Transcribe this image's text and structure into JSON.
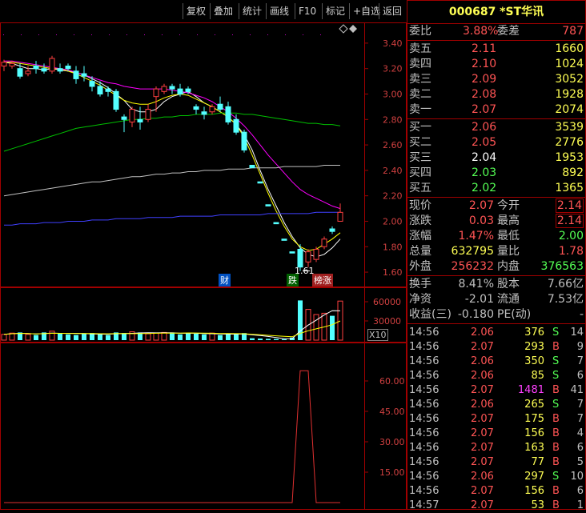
{
  "toolbar": {
    "buttons": [
      "复权",
      "叠加",
      "统计",
      "画线",
      "F10",
      "标记",
      "+自选",
      "返回"
    ]
  },
  "kchart": {
    "yticks": [
      "3.40",
      "3.20",
      "3.00",
      "2.80",
      "2.60",
      "2.40",
      "2.20",
      "2.00",
      "1.80",
      "1.60"
    ],
    "low_label": "1.61",
    "tags": {
      "cai": "财",
      "die": "跌",
      "bang": "榜涨"
    }
  },
  "volume": {
    "yticks": [
      "60000",
      "30000"
    ],
    "unit": "X10"
  },
  "indicator": {
    "yticks": [
      "60.00",
      "45.00",
      "30.00",
      "15.00"
    ]
  },
  "quote": {
    "title": "000687 *ST华讯",
    "weibi_label": "委比",
    "weibi": "3.88%",
    "weicha_label": "委差",
    "weicha": "787",
    "asks": [
      {
        "label": "卖五",
        "price": "2.11",
        "vol": "1660"
      },
      {
        "label": "卖四",
        "price": "2.10",
        "vol": "1024"
      },
      {
        "label": "卖三",
        "price": "2.09",
        "vol": "3052"
      },
      {
        "label": "卖二",
        "price": "2.08",
        "vol": "1928"
      },
      {
        "label": "卖一",
        "price": "2.07",
        "vol": "2074"
      }
    ],
    "bids": [
      {
        "label": "买一",
        "price": "2.06",
        "vol": "3539"
      },
      {
        "label": "买二",
        "price": "2.05",
        "vol": "2776"
      },
      {
        "label": "买三",
        "price": "2.04",
        "vol": "1953"
      },
      {
        "label": "买四",
        "price": "2.03",
        "vol": "892"
      },
      {
        "label": "买五",
        "price": "2.02",
        "vol": "1365"
      }
    ],
    "stats": [
      {
        "l1": "现价",
        "v1": "2.07",
        "l2": "今开",
        "v2": "2.14"
      },
      {
        "l1": "涨跌",
        "v1": "0.03",
        "l2": "最高",
        "v2": "2.14"
      },
      {
        "l1": "涨幅",
        "v1": "1.47%",
        "l2": "最低",
        "v2": "2.00"
      },
      {
        "l1": "总量",
        "v1": "632795",
        "l2": "量比",
        "v2": "1.78"
      },
      {
        "l1": "外盘",
        "v1": "256232",
        "l2": "内盘",
        "v2": "376563"
      }
    ],
    "stats2": [
      {
        "l1": "换手",
        "v1": "8.41%",
        "l2": "股本",
        "v2": "7.66亿"
      },
      {
        "l1": "净资",
        "v1": "-2.01",
        "l2": "流通",
        "v2": "7.53亿"
      },
      {
        "l1": "收益(三)",
        "v1": "-0.180",
        "l2": "PE(动)",
        "v2": "-"
      }
    ],
    "ticks": [
      {
        "t": "14:56",
        "p": "2.06",
        "v": "376",
        "s": "S",
        "n": "14"
      },
      {
        "t": "14:56",
        "p": "2.07",
        "v": "293",
        "s": "B",
        "n": "9"
      },
      {
        "t": "14:56",
        "p": "2.06",
        "v": "350",
        "s": "S",
        "n": "7"
      },
      {
        "t": "14:56",
        "p": "2.06",
        "v": "85",
        "s": "S",
        "n": "6"
      },
      {
        "t": "14:56",
        "p": "2.07",
        "v": "1481",
        "s": "B",
        "n": "41"
      },
      {
        "t": "14:56",
        "p": "2.06",
        "v": "265",
        "s": "S",
        "n": "7"
      },
      {
        "t": "14:56",
        "p": "2.07",
        "v": "175",
        "s": "B",
        "n": "7"
      },
      {
        "t": "14:56",
        "p": "2.07",
        "v": "156",
        "s": "B",
        "n": "4"
      },
      {
        "t": "14:56",
        "p": "2.07",
        "v": "163",
        "s": "B",
        "n": "6"
      },
      {
        "t": "14:56",
        "p": "2.07",
        "v": "77",
        "s": "B",
        "n": "5"
      },
      {
        "t": "14:56",
        "p": "2.06",
        "v": "297",
        "s": "S",
        "n": "10"
      },
      {
        "t": "14:56",
        "p": "2.07",
        "v": "156",
        "s": "B",
        "n": "6"
      },
      {
        "t": "14:57",
        "p": "2.07",
        "v": "53",
        "s": "B",
        "n": "1"
      }
    ]
  },
  "chart_data": {
    "type": "candlestick",
    "y_range": [
      1.55,
      3.5
    ],
    "candles": [
      {
        "o": 3.22,
        "c": 3.25,
        "h": 3.27,
        "l": 3.18
      },
      {
        "o": 3.22,
        "c": 3.24,
        "h": 3.26,
        "l": 3.2
      },
      {
        "o": 3.2,
        "c": 3.14,
        "h": 3.24,
        "l": 3.12
      },
      {
        "o": 3.16,
        "c": 3.18,
        "h": 3.22,
        "l": 3.14
      },
      {
        "o": 3.22,
        "c": 3.2,
        "h": 3.26,
        "l": 3.16
      },
      {
        "o": 3.2,
        "c": 3.18,
        "h": 3.24,
        "l": 3.16
      },
      {
        "o": 3.18,
        "c": 3.28,
        "h": 3.3,
        "l": 3.16
      },
      {
        "o": 3.2,
        "c": 3.18,
        "h": 3.24,
        "l": 3.16
      },
      {
        "o": 3.22,
        "c": 3.2,
        "h": 3.24,
        "l": 3.18
      },
      {
        "o": 3.18,
        "c": 3.12,
        "h": 3.22,
        "l": 3.08
      },
      {
        "o": 3.16,
        "c": 3.14,
        "h": 3.22,
        "l": 3.1
      },
      {
        "o": 3.1,
        "c": 3.06,
        "h": 3.14,
        "l": 3.02
      },
      {
        "o": 3.06,
        "c": 3.0,
        "h": 3.1,
        "l": 2.98
      },
      {
        "o": 3.04,
        "c": 3.02,
        "h": 3.06,
        "l": 2.98
      },
      {
        "o": 3.02,
        "c": 2.88,
        "h": 3.04,
        "l": 2.86
      },
      {
        "o": 2.82,
        "c": 2.8,
        "h": 2.84,
        "l": 2.7
      },
      {
        "o": 2.78,
        "c": 2.88,
        "h": 2.9,
        "l": 2.74
      },
      {
        "o": 2.8,
        "c": 2.78,
        "h": 2.9,
        "l": 2.72
      },
      {
        "o": 2.8,
        "c": 2.88,
        "h": 2.92,
        "l": 2.78
      },
      {
        "o": 2.98,
        "c": 3.04,
        "h": 3.06,
        "l": 2.86
      },
      {
        "o": 3.02,
        "c": 3.06,
        "h": 3.08,
        "l": 3.0
      },
      {
        "o": 3.06,
        "c": 3.04,
        "h": 3.08,
        "l": 3.0
      },
      {
        "o": 3.04,
        "c": 3.0,
        "h": 3.08,
        "l": 2.98
      },
      {
        "o": 3.04,
        "c": 3.02,
        "h": 3.06,
        "l": 3.0
      },
      {
        "o": 2.9,
        "c": 2.88,
        "h": 2.92,
        "l": 2.84
      },
      {
        "o": 2.86,
        "c": 2.84,
        "h": 2.9,
        "l": 2.8
      },
      {
        "o": 2.86,
        "c": 2.9,
        "h": 2.92,
        "l": 2.84
      },
      {
        "o": 2.92,
        "c": 2.88,
        "h": 2.98,
        "l": 2.86
      },
      {
        "o": 2.9,
        "c": 2.78,
        "h": 2.94,
        "l": 2.76
      },
      {
        "o": 2.8,
        "c": 2.7,
        "h": 2.84,
        "l": 2.68
      },
      {
        "o": 2.7,
        "c": 2.56,
        "h": 2.72,
        "l": 2.54
      },
      {
        "o": 2.44,
        "c": 2.42,
        "h": 2.44,
        "l": 2.42
      },
      {
        "o": 2.31,
        "c": 2.3,
        "h": 2.31,
        "l": 2.3
      },
      {
        "o": 2.13,
        "c": 2.12,
        "h": 2.13,
        "l": 2.12
      },
      {
        "o": 1.99,
        "c": 1.98,
        "h": 1.99,
        "l": 1.98
      },
      {
        "o": 1.86,
        "c": 1.85,
        "h": 1.86,
        "l": 1.85
      },
      {
        "o": 1.76,
        "c": 1.75,
        "h": 1.76,
        "l": 1.75
      },
      {
        "o": 1.78,
        "c": 1.64,
        "h": 1.82,
        "l": 1.61
      },
      {
        "o": 1.68,
        "c": 1.76,
        "h": 1.78,
        "l": 1.64
      },
      {
        "o": 1.7,
        "c": 1.78,
        "h": 1.8,
        "l": 1.68
      },
      {
        "o": 1.8,
        "c": 1.86,
        "h": 1.88,
        "l": 1.78
      },
      {
        "o": 1.94,
        "c": 1.92,
        "h": 1.96,
        "l": 1.9
      },
      {
        "o": 2.0,
        "c": 2.07,
        "h": 2.14,
        "l": 2.0
      }
    ],
    "ma_series": [
      {
        "color": "#ffffff",
        "values": [
          3.25,
          3.24,
          3.22,
          3.2,
          3.2,
          3.19,
          3.2,
          3.19,
          3.18,
          3.17,
          3.15,
          3.12,
          3.09,
          3.05,
          3.0,
          2.95,
          2.88,
          2.86,
          2.86,
          2.88,
          2.94,
          2.98,
          3.0,
          3.02,
          2.98,
          2.93,
          2.9,
          2.86,
          2.82,
          2.76,
          2.68,
          2.56,
          2.4,
          2.25,
          2.12,
          1.99,
          1.88,
          1.79,
          1.74,
          1.72,
          1.74,
          1.79,
          1.86
        ]
      },
      {
        "color": "#ffff00",
        "values": [
          3.25,
          3.25,
          3.24,
          3.23,
          3.22,
          3.21,
          3.2,
          3.2,
          3.18,
          3.16,
          3.13,
          3.1,
          3.07,
          3.03,
          2.99,
          2.95,
          2.93,
          2.92,
          2.92,
          2.94,
          2.97,
          2.99,
          3.0,
          2.99,
          2.96,
          2.93,
          2.9,
          2.86,
          2.82,
          2.76,
          2.66,
          2.52,
          2.37,
          2.22,
          2.08,
          1.96,
          1.86,
          1.8,
          1.77,
          1.78,
          1.82,
          1.86,
          1.91
        ]
      },
      {
        "color": "#ff00ff",
        "values": [
          3.26,
          3.26,
          3.25,
          3.24,
          3.23,
          3.22,
          3.21,
          3.2,
          3.19,
          3.17,
          3.15,
          3.13,
          3.11,
          3.09,
          3.08,
          3.06,
          3.05,
          3.04,
          3.04,
          3.04,
          3.04,
          3.03,
          3.02,
          3.01,
          2.99,
          2.97,
          2.94,
          2.9,
          2.86,
          2.81,
          2.75,
          2.68,
          2.6,
          2.52,
          2.45,
          2.38,
          2.31,
          2.25,
          2.21,
          2.18,
          2.15,
          2.12,
          2.1
        ]
      },
      {
        "color": "#00c000",
        "values": [
          2.55,
          2.57,
          2.59,
          2.61,
          2.63,
          2.65,
          2.67,
          2.69,
          2.71,
          2.73,
          2.74,
          2.75,
          2.76,
          2.77,
          2.78,
          2.79,
          2.8,
          2.8,
          2.81,
          2.81,
          2.82,
          2.82,
          2.83,
          2.83,
          2.84,
          2.84,
          2.84,
          2.85,
          2.85,
          2.85,
          2.84,
          2.84,
          2.83,
          2.82,
          2.81,
          2.8,
          2.79,
          2.78,
          2.77,
          2.77,
          2.76,
          2.76,
          2.75
        ]
      },
      {
        "color": "#c0c0c0",
        "values": [
          2.2,
          2.21,
          2.22,
          2.23,
          2.24,
          2.25,
          2.26,
          2.27,
          2.28,
          2.29,
          2.3,
          2.31,
          2.31,
          2.32,
          2.33,
          2.34,
          2.35,
          2.35,
          2.36,
          2.37,
          2.37,
          2.38,
          2.38,
          2.39,
          2.39,
          2.4,
          2.4,
          2.4,
          2.41,
          2.41,
          2.41,
          2.42,
          2.42,
          2.42,
          2.42,
          2.43,
          2.43,
          2.43,
          2.43,
          2.43,
          2.44,
          2.44,
          2.44
        ]
      },
      {
        "color": "#4040ff",
        "values": [
          1.97,
          1.97,
          1.98,
          1.98,
          1.98,
          1.99,
          1.99,
          1.99,
          2.0,
          2.0,
          2.0,
          2.01,
          2.01,
          2.01,
          2.02,
          2.02,
          2.02,
          2.02,
          2.03,
          2.03,
          2.03,
          2.03,
          2.04,
          2.04,
          2.04,
          2.04,
          2.04,
          2.05,
          2.05,
          2.05,
          2.05,
          2.05,
          2.05,
          2.06,
          2.06,
          2.06,
          2.06,
          2.06,
          2.06,
          2.07,
          2.07,
          2.07,
          2.07
        ]
      }
    ],
    "volumes": [
      9000,
      11000,
      12000,
      9000,
      8000,
      12000,
      14000,
      10000,
      9000,
      8000,
      10000,
      11000,
      9000,
      8000,
      12000,
      11000,
      13000,
      12000,
      10000,
      11000,
      12000,
      12000,
      9000,
      11000,
      10000,
      9000,
      11000,
      8000,
      9000,
      10000,
      11000,
      3000,
      2500,
      2000,
      1800,
      1500,
      4000,
      62000,
      48000,
      40000,
      42000,
      38000,
      61000
    ],
    "vol_range": [
      0,
      75000
    ],
    "indicator_peaks": [
      {
        "index": 37,
        "value": 65
      },
      {
        "index": 38,
        "value": 65
      }
    ],
    "indicator_range": [
      0,
      75
    ]
  }
}
